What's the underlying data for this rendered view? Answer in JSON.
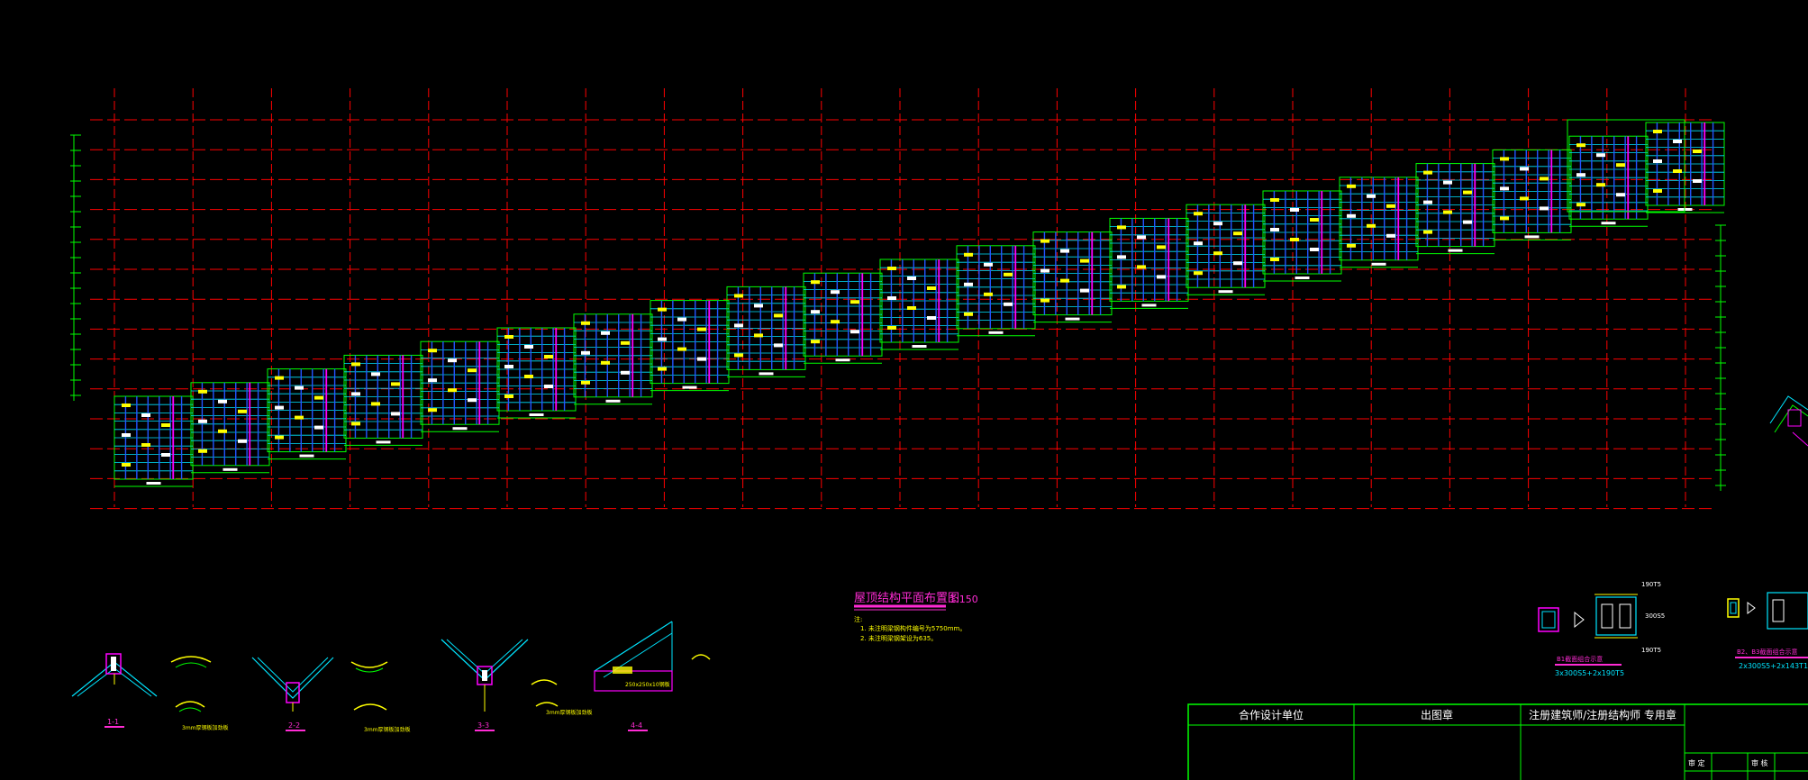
{
  "drawing": {
    "title": "屋顶结构平面布置图",
    "scale": "1:150",
    "notes_heading": "注:",
    "notes": [
      "1. 未注明梁钢构件编号为5750mm。",
      "2. 未注明梁钢架设为635。"
    ]
  },
  "sections": [
    {
      "tag": "1-1",
      "note": "3mm厚钢板加劲板"
    },
    {
      "tag": "2-2",
      "note": "3mm厚钢板加劲板"
    },
    {
      "tag": "3-3",
      "note": "3mm厚钢板加劲板"
    },
    {
      "tag": "4-4",
      "note": ""
    }
  ],
  "section_detail": {
    "plate": "250x250x10钢板"
  },
  "member_details": [
    {
      "title": "B1截面组合示意",
      "spec": "3x300S5+2x190T5",
      "dim_top": "190T5",
      "dim_mid": "300S5",
      "dim_bottom": "190T5"
    },
    {
      "title": "B2、B3截面组合示意",
      "spec": "2x300S5+2x143T1"
    }
  ],
  "title_block": {
    "headers": [
      "合作设计单位",
      "出图章",
      "注册建筑师/注册结构师 专用章"
    ],
    "stamps": [
      "审 定",
      "审 核"
    ]
  },
  "colors": {
    "background": "#000000",
    "grid": "#ff0000",
    "outline": "#00ff00",
    "member_blue": "#2255ff",
    "member_cyan": "#00e5ff",
    "member_magenta": "#ff00ff",
    "label_yellow": "#ffff00",
    "title_magenta": "#ff2bd4",
    "frame": "#00ff00"
  }
}
